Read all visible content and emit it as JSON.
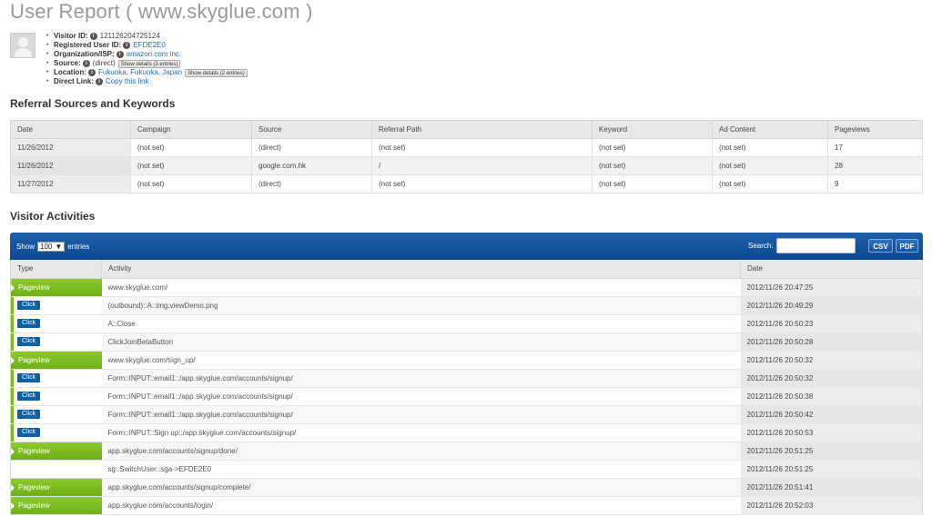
{
  "page": {
    "title": "User Report ( www.skyglue.com )"
  },
  "visitor": [
    {
      "label": "Visitor ID:",
      "value": "121126204725124",
      "link": false
    },
    {
      "label": "Registered User ID:",
      "value": "EFDE2E0",
      "link": true
    },
    {
      "label": "Organization/ISP:",
      "value": "amazon.com inc.",
      "link": true
    },
    {
      "label": "Source:",
      "value": "(direct)",
      "link": false,
      "button": "Show details (3 entries)"
    },
    {
      "label": "Location:",
      "value": "Fukuoka, Fukuoka, Japan",
      "link": true,
      "button": "Show details (2 entries)"
    },
    {
      "label": "Direct Link:",
      "value": "Copy this link",
      "link": true
    }
  ],
  "referral": {
    "heading": "Referral Sources and Keywords",
    "columns": [
      "Date",
      "Campaign",
      "Source",
      "Referral Path",
      "Keyword",
      "Ad Content",
      "Pageviews"
    ],
    "rows": [
      [
        "11/26/2012",
        "(not set)",
        "(direct)",
        "(not set)",
        "(not set)",
        "(not set)",
        "17"
      ],
      [
        "11/26/2012",
        "(not set)",
        "google.com.hk",
        "/",
        "(not set)",
        "(not set)",
        "28"
      ],
      [
        "11/27/2012",
        "(not set)",
        "(direct)",
        "(not set)",
        "(not set)",
        "(not set)",
        "9"
      ]
    ]
  },
  "activities": {
    "heading": "Visitor Activities",
    "show_label": "Show",
    "entries_value": "100",
    "entries_label": "entries",
    "search_label": "Search:",
    "csv_label": "CSV",
    "pdf_label": "PDF",
    "columns": [
      "Type",
      "Activity",
      "Date"
    ],
    "rows": [
      {
        "type": "Pageview",
        "activity": "www.skyglue.com/",
        "date": "2012/11/26 20:47:25"
      },
      {
        "type": "Click",
        "activity": "(outbound)::A::img:viewDemo.png",
        "date": "2012/11/26 20:49:29"
      },
      {
        "type": "Click",
        "activity": "A::Close",
        "date": "2012/11/26 20:50:23"
      },
      {
        "type": "Click",
        "activity": "ClickJoinBetaButton",
        "date": "2012/11/26 20:50:28"
      },
      {
        "type": "Pageview",
        "activity": "www.skyglue.com/sign_up/",
        "date": "2012/11/26 20:50:32"
      },
      {
        "type": "Click",
        "activity": "Form::INPUT::email1::/app.skyglue.com/accounts/signup/",
        "date": "2012/11/26 20:50:32"
      },
      {
        "type": "Click",
        "activity": "Form::INPUT::email1::/app.skyglue.com/accounts/signup/",
        "date": "2012/11/26 20:50:38"
      },
      {
        "type": "Click",
        "activity": "Form::INPUT::email1::/app.skyglue.com/accounts/signup/",
        "date": "2012/11/26 20:50:42"
      },
      {
        "type": "Click",
        "activity": "Form::INPUT::Sign up::/app.skyglue.com/accounts/signup/",
        "date": "2012/11/26 20:50:53"
      },
      {
        "type": "Pageview",
        "activity": "app.skyglue.com/accounts/signup/done/",
        "date": "2012/11/26 20:51:25"
      },
      {
        "type": "",
        "activity": "sg::SwitchUser::sga->EFDE2E0",
        "date": "2012/11/26 20:51:25"
      },
      {
        "type": "Pageview",
        "activity": "app.skyglue.com/accounts/signup/complete/",
        "date": "2012/11/26 20:51:41"
      },
      {
        "type": "Pageview",
        "activity": "app.skyglue.com/accounts/login/",
        "date": "2012/11/26 20:52:03"
      }
    ]
  }
}
